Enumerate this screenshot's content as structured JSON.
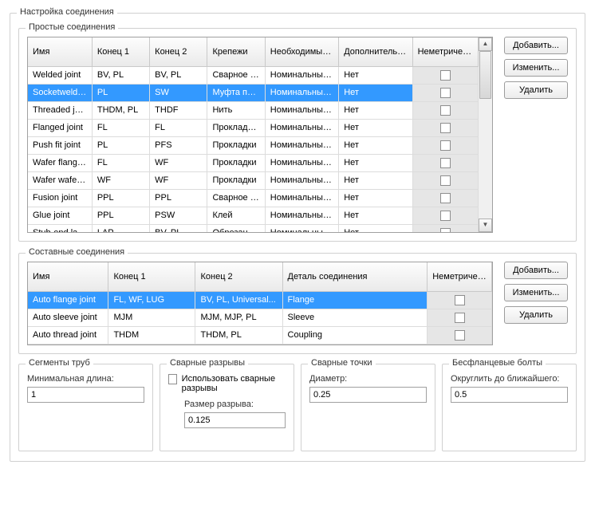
{
  "title": "Настройка соединения",
  "simple": {
    "title": "Простые соединения",
    "cols": [
      "Имя",
      "Конец 1",
      "Конец 2",
      "Крепежи",
      "Необходимые соответствия",
      "Дополнительные соответствия",
      "Неметрическое соединение"
    ],
    "rows": [
      {
        "c": [
          "Welded joint",
          "BV, PL",
          "BV, PL",
          "Сварное с...",
          "Номинальный д...",
          "Нет"
        ],
        "sel": false
      },
      {
        "c": [
          "Socketwelded...",
          "PL",
          "SW",
          "Муфта при...",
          "Номинальный д...",
          "Нет"
        ],
        "sel": true
      },
      {
        "c": [
          "Threaded joint",
          "THDM, PL",
          "THDF",
          "Нить",
          "Номинальный д...",
          "Нет"
        ],
        "sel": false
      },
      {
        "c": [
          "Flanged joint",
          "FL",
          "FL",
          "Прокладки...",
          "Номинальный д...",
          "Нет"
        ],
        "sel": false
      },
      {
        "c": [
          "Push fit joint",
          "PL",
          "PFS",
          "Прокладки",
          "Номинальный д...",
          "Нет"
        ],
        "sel": false
      },
      {
        "c": [
          "Wafer flanged...",
          "FL",
          "WF",
          "Прокладки",
          "Номинальный д...",
          "Нет"
        ],
        "sel": false
      },
      {
        "c": [
          "Wafer wafer j...",
          "WF",
          "WF",
          "Прокладки",
          "Номинальный д...",
          "Нет"
        ],
        "sel": false
      },
      {
        "c": [
          "Fusion joint",
          "PPL",
          "PPL",
          "Сварное с...",
          "Номинальный д...",
          "Нет"
        ],
        "sel": false
      },
      {
        "c": [
          "Glue joint",
          "PPL",
          "PSW",
          "Клей",
          "Номинальный д...",
          "Нет"
        ],
        "sel": false
      },
      {
        "c": [
          "Stub-end lapp...",
          "LAP",
          "BV, PL",
          "Обрезанн...",
          "Номинальный д...",
          "Нет"
        ],
        "sel": false
      }
    ]
  },
  "compound": {
    "title": "Составные соединения",
    "cols": [
      "Имя",
      "Конец 1",
      "Конец 2",
      "Деталь соединения",
      "Неметрическое соединение"
    ],
    "rows": [
      {
        "c": [
          "Auto flange joint",
          "FL, WF, LUG",
          "BV, PL, Universal...",
          "Flange"
        ],
        "sel": true
      },
      {
        "c": [
          "Auto sleeve joint",
          "MJM",
          "MJM, MJP, PL",
          "Sleeve"
        ],
        "sel": false
      },
      {
        "c": [
          "Auto thread joint",
          "THDM",
          "THDM, PL",
          "Coupling"
        ],
        "sel": false
      }
    ]
  },
  "buttons": {
    "add": "Добавить...",
    "edit": "Изменить...",
    "del": "Удалить"
  },
  "segments": {
    "title": "Сегменты труб",
    "minlen_label": "Минимальная длина:",
    "minlen": "1"
  },
  "weldgaps": {
    "title": "Сварные разрывы",
    "use_label": "Использовать сварные разрывы",
    "size_label": "Размер разрыва:",
    "size": "0.125"
  },
  "weldpoints": {
    "title": "Сварные точки",
    "diam_label": "Диаметр:",
    "diam": "0.25"
  },
  "flangeless": {
    "title": "Бесфланцевые болты",
    "round_label": "Округлить до ближайшего:",
    "round": "0.5"
  }
}
